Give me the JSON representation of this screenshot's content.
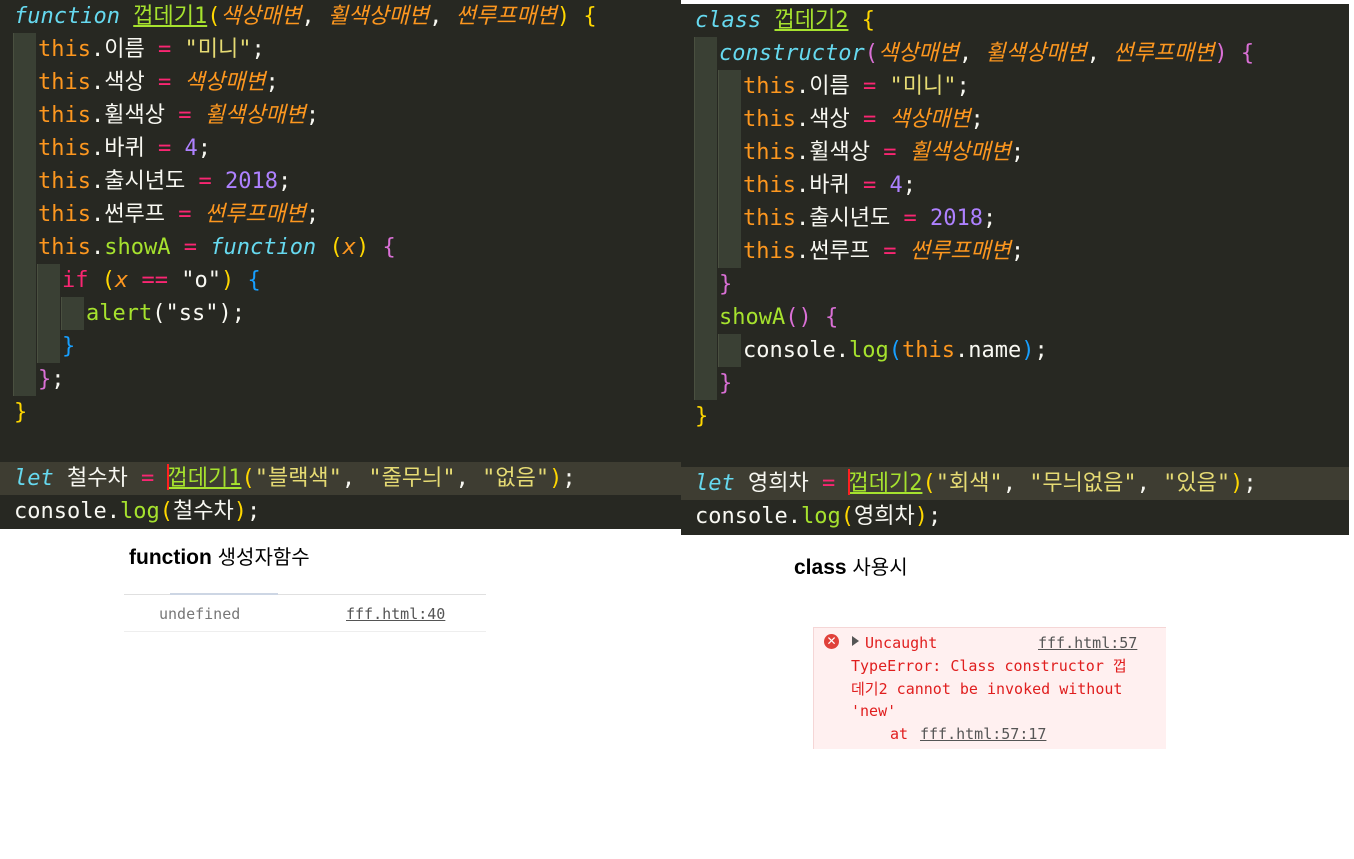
{
  "left_code": {
    "fn_keyword": "function",
    "fn_name": "껍데기1",
    "params": [
      "색상매변",
      "휠색상매변",
      "썬루프매변"
    ],
    "this_kw": "this",
    "props": {
      "name": "이름",
      "color": "색상",
      "wheel": "휠색상",
      "wheels": "바퀴",
      "year": "출시년도",
      "sunroof": "썬루프",
      "method": "showA"
    },
    "values": {
      "name": "\"미니\"",
      "wheels": "4",
      "year": "2018"
    },
    "inner_fn_keyword": "function",
    "inner_param": "x",
    "if_keyword": "if",
    "cond_op": "==",
    "cond_value": "\"o\"",
    "alert_fn": "alert",
    "alert_arg": "\"ss\"",
    "let_keyword": "let",
    "var_name": "철수차",
    "call_args": [
      "\"블랙색\"",
      "\"줄무늬\"",
      "\"없음\""
    ],
    "console_obj": "console",
    "log_fn": "log"
  },
  "right_code": {
    "class_keyword": "class",
    "class_name": "껍데기2",
    "constructor_kw": "constructor",
    "params": [
      "색상매변",
      "휠색상매변",
      "썬루프매변"
    ],
    "this_kw": "this",
    "method": "showA",
    "log_target": "name",
    "let_keyword": "let",
    "var_name": "영희차",
    "call_args": [
      "\"회색\"",
      "\"무늬없음\"",
      "\"있음\""
    ],
    "console_obj": "console",
    "log_fn": "log"
  },
  "captions": {
    "left_bold": "function",
    "left_rest": "생성자함수",
    "right_bold": "class",
    "right_rest": "사용시"
  },
  "console_left": {
    "value": "undefined",
    "source": "fff.html:40"
  },
  "console_right": {
    "title": "Uncaught",
    "source": "fff.html:57",
    "line1": "TypeError: Class constructor 껍",
    "line2": "데기2 cannot be invoked without",
    "line3": "'new'",
    "at": "at",
    "at_source": "fff.html:57:17"
  },
  "colors": {
    "editor_bg": "#272822",
    "keyword": "#66d9ef",
    "operator": "#f92672",
    "string": "#e6db74",
    "number": "#ae81ff",
    "param": "#fd971f",
    "function": "#a6e22e",
    "error": "#e01e1e"
  }
}
